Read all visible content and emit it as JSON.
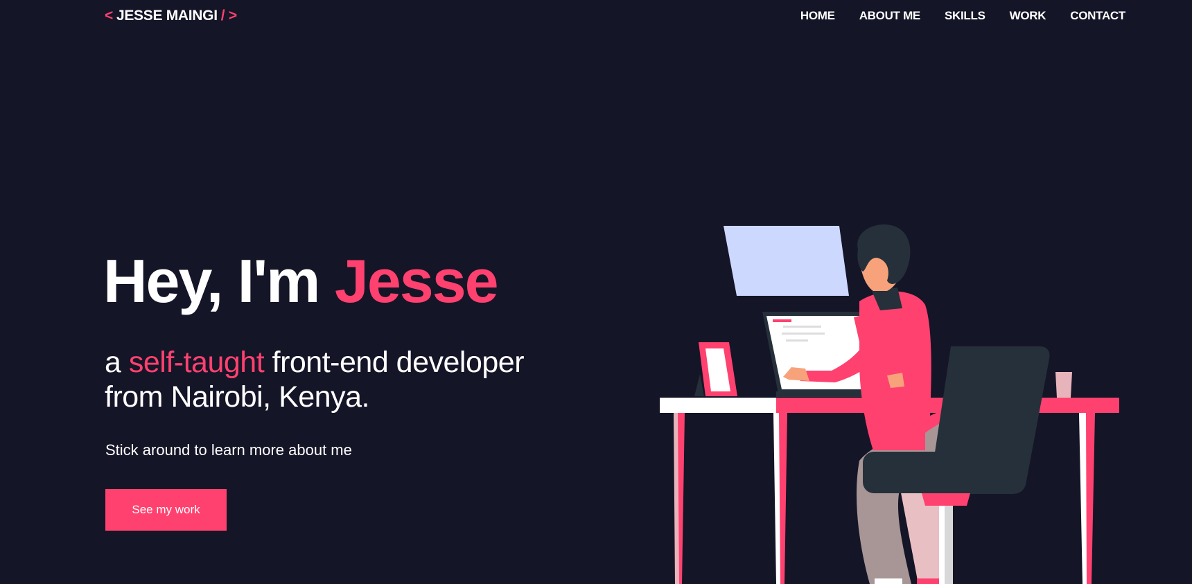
{
  "brand": {
    "open": "<",
    "name": "JESSE MAINGI",
    "close": "/ >"
  },
  "nav": {
    "items": [
      "HOME",
      "ABOUT ME",
      "SKILLS",
      "WORK",
      "CONTACT"
    ]
  },
  "hero": {
    "greeting": "Hey, I'm",
    "name": "Jesse",
    "sub_prefix": "a",
    "sub_highlight": "self-taught",
    "sub_rest": "front-end developer",
    "sub_line2": "from Nairobi, Kenya.",
    "note": "Stick around to learn more about me",
    "cta": "See my work"
  },
  "colors": {
    "background": "#151528",
    "accent": "#ff416f",
    "text": "#ffffff"
  },
  "icons": {
    "illustration": "developer-at-desk-illustration"
  }
}
